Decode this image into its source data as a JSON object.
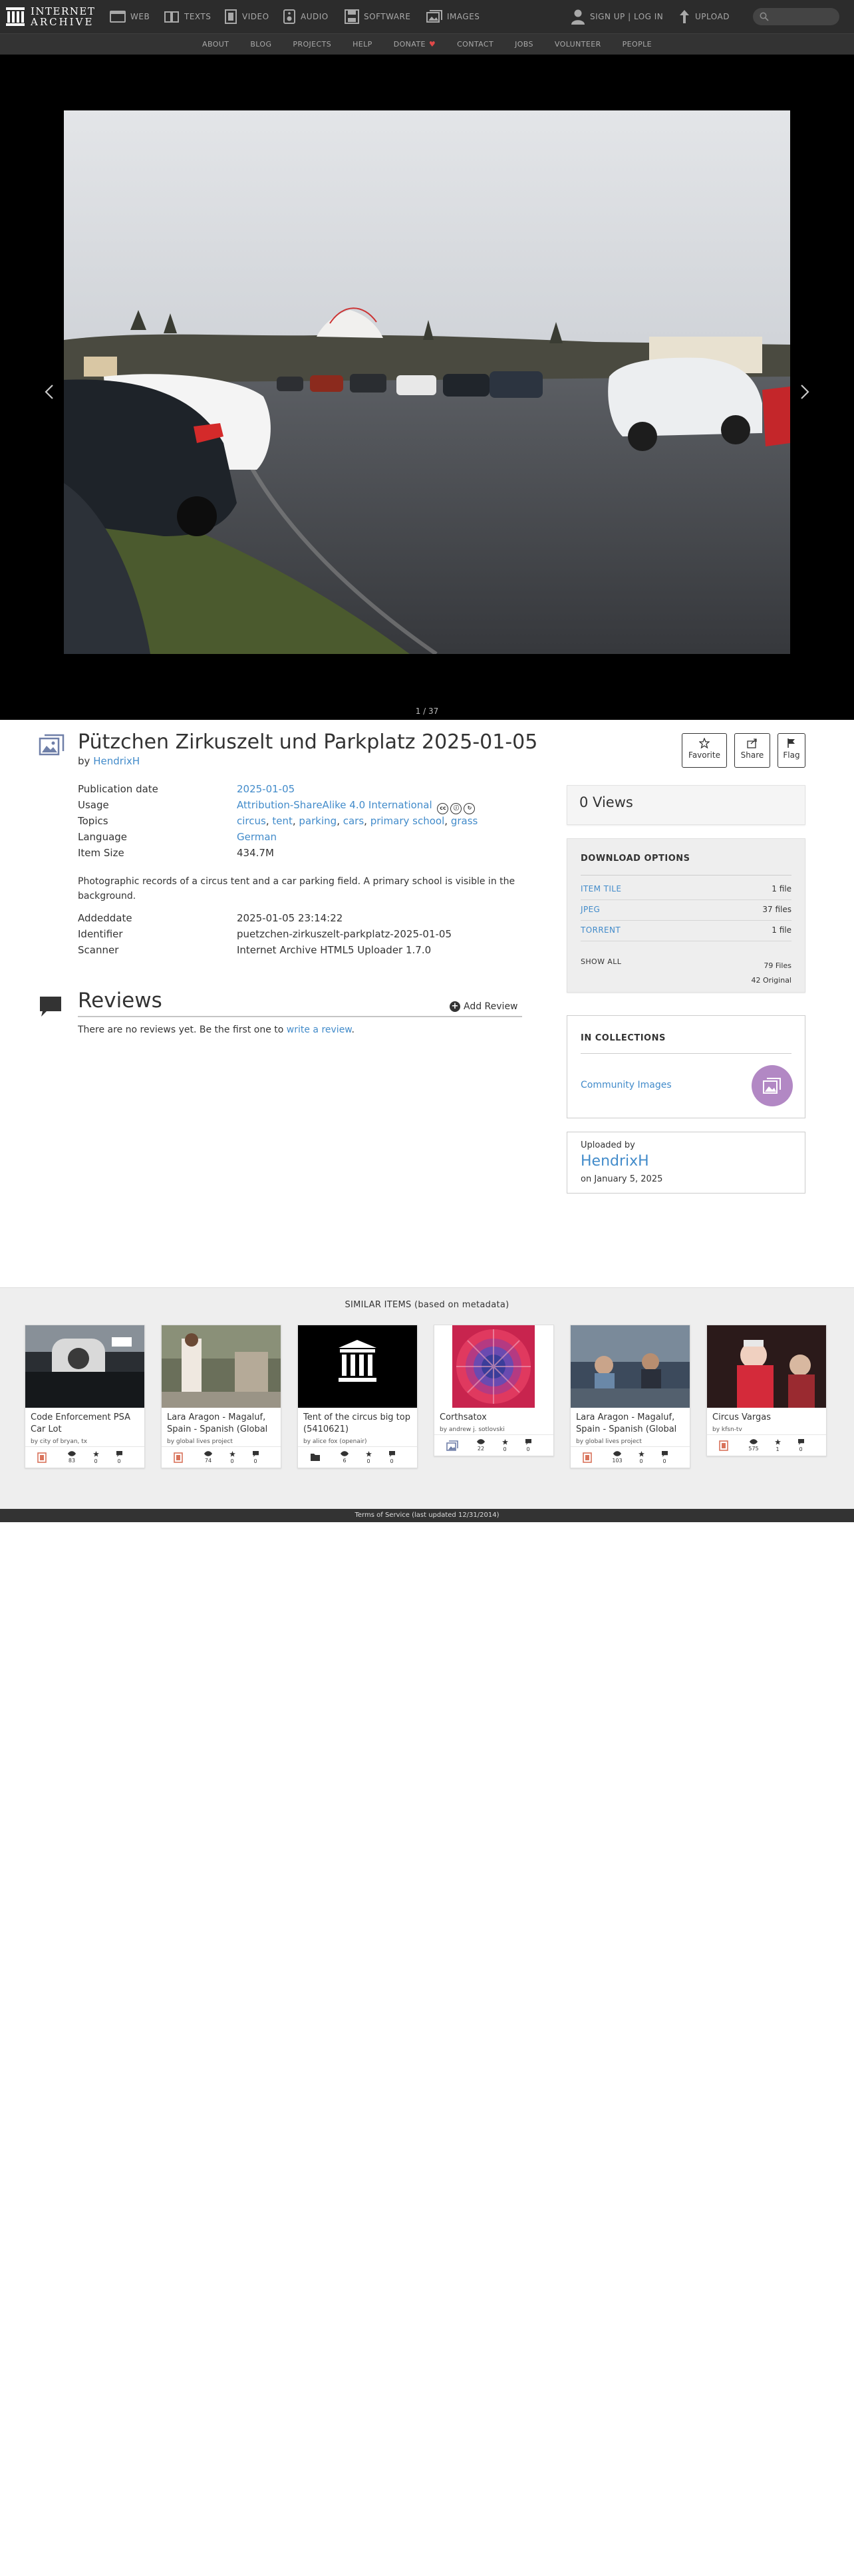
{
  "nav": {
    "logo_line1": "INTERNET",
    "logo_line2": "ARCHIVE",
    "links": [
      "WEB",
      "TEXTS",
      "VIDEO",
      "AUDIO",
      "SOFTWARE",
      "IMAGES"
    ],
    "signup": "SIGN UP | LOG IN",
    "upload": "UPLOAD"
  },
  "subnav": [
    "ABOUT",
    "BLOG",
    "PROJECTS",
    "HELP",
    "DONATE",
    "CONTACT",
    "JOBS",
    "VOLUNTEER",
    "PEOPLE"
  ],
  "theater": {
    "pager": "1 / 37"
  },
  "item": {
    "title": "Pützchen Zirkuszelt und Parkplatz 2025-01-05",
    "by_prefix": "by",
    "creator": "HendrixH",
    "actions": [
      "Favorite",
      "Share",
      "Flag"
    ]
  },
  "metadata": {
    "pubdate_key": "Publication date",
    "pubdate": "2025-01-05",
    "usage_key": "Usage",
    "usage": "Attribution-ShareAlike 4.0 International",
    "topics_key": "Topics",
    "topics": [
      "circus",
      "tent",
      "parking",
      "cars",
      "primary school",
      "grass"
    ],
    "language_key": "Language",
    "language": "German",
    "size_key": "Item Size",
    "size": "434.7M",
    "description": "Photographic records of a circus tent and a car parking field. A primary school is visible in the background.",
    "addeddate_key": "Addeddate",
    "addeddate": "2025-01-05 23:14:22",
    "identifier_key": "Identifier",
    "identifier": "puetzchen-zirkuszelt-parkplatz-2025-01-05",
    "scanner_key": "Scanner",
    "scanner": "Internet Archive HTML5 Uploader 1.7.0"
  },
  "reviews": {
    "title": "Reviews",
    "add": "Add Review",
    "empty_text": "There are no reviews yet. Be the first one to",
    "empty_link": "write a review",
    "empty_end": "."
  },
  "sidebar": {
    "views": "0 Views",
    "download_title": "DOWNLOAD OPTIONS",
    "downloads": [
      {
        "format": "ITEM TILE",
        "count": "1 file"
      },
      {
        "format": "JPEG",
        "count": "37 files"
      },
      {
        "format": "TORRENT",
        "count": "1 file"
      }
    ],
    "show_all": "SHOW ALL",
    "files_total": "79 Files",
    "files_original": "42 Original",
    "collections_title": "IN COLLECTIONS",
    "collection": "Community Images",
    "uploaded_by_label": "Uploaded by",
    "uploader": "HendrixH",
    "uploaded_on": "on January 5, 2025"
  },
  "similar": {
    "title": "SIMILAR ITEMS (based on metadata)",
    "items": [
      {
        "title": "Code Enforcement PSA Car Lot",
        "by": "by city of bryan, tx",
        "views": "83",
        "favs": "0",
        "reviews": "0",
        "type": "film-icon"
      },
      {
        "title": "Lara Aragon - Magaluf, Spain - Spanish (Global",
        "by": "by global lives project",
        "views": "74",
        "favs": "0",
        "reviews": "0",
        "type": "film-icon"
      },
      {
        "title": "Tent of the circus big top (5410621)",
        "by": "by alice fox (openair)",
        "views": "6",
        "favs": "0",
        "reviews": "0",
        "type": "folder-icon"
      },
      {
        "title": "Corthsatox",
        "by": "by andrew j. sotlovski",
        "views": "22",
        "favs": "0",
        "reviews": "0",
        "type": "image-icon"
      },
      {
        "title": "Lara Aragon - Magaluf, Spain - Spanish (Global",
        "by": "by global lives project",
        "views": "103",
        "favs": "0",
        "reviews": "0",
        "type": "film-icon"
      },
      {
        "title": "Circus Vargas",
        "by": "by kfsn-tv",
        "views": "575",
        "favs": "1",
        "reviews": "0",
        "type": "film-icon"
      }
    ]
  },
  "footer": {
    "text": "Terms of Service (last updated 12/31/2014)"
  },
  "colors": {
    "link": "#428bca",
    "nav_bg": "#2c2c2c",
    "subnav_bg": "#333333",
    "heart": "#e04848",
    "collection_thumb": "#b288c4"
  }
}
